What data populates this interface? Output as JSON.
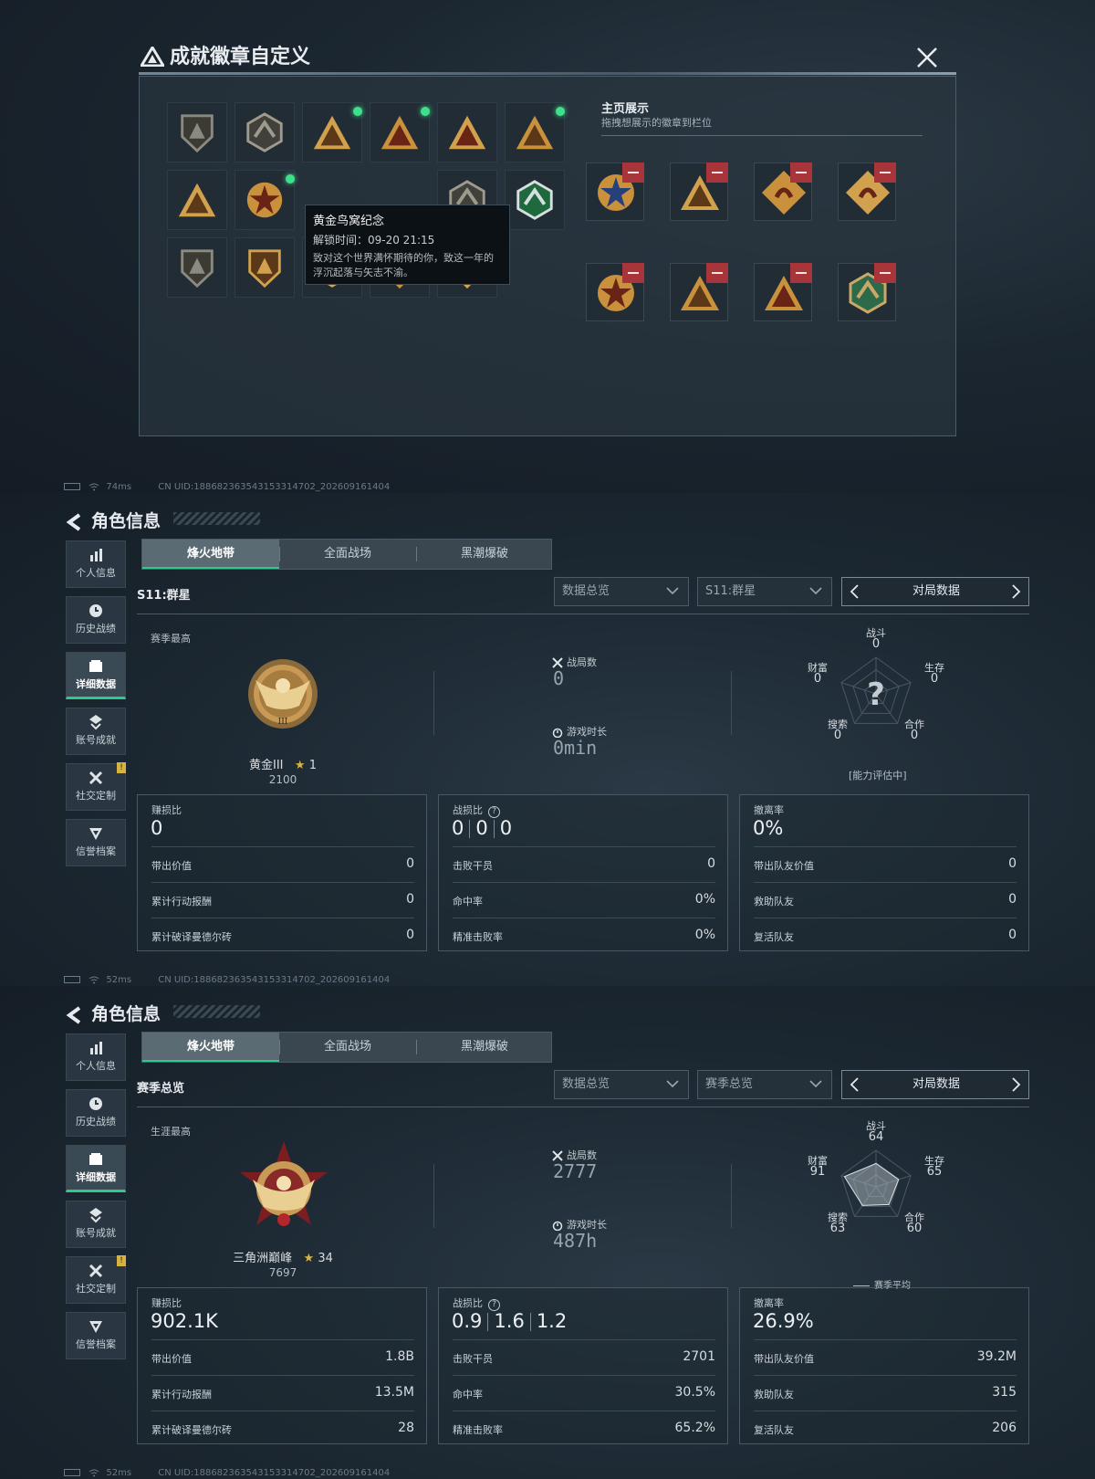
{
  "dialog": {
    "title": "成就徽章自定义",
    "tooltip": {
      "name": "黄金鸟窝纪念",
      "unlock": "解锁时间：09-20 21:15",
      "desc": "致对这个世界满怀期待的你，致这一年的浮沉起落与矢志不渝。"
    },
    "showcase_title": "主页展示",
    "showcase_hint": "拖拽想展示的徽章到栏位"
  },
  "status": [
    {
      "ping": "74ms",
      "uid": "CN UID:18868236354315331470​2_202609161404"
    },
    {
      "ping": "52ms",
      "uid": "CN UID:18868236354315331470​2_202609161404"
    },
    {
      "ping": "52ms",
      "uid": "CN UID:18868236354315331470​2_202609161404"
    }
  ],
  "nav": {
    "title": "角色信息",
    "side": [
      "个人信息",
      "历史战绩",
      "详细数据",
      "账号成就",
      "社交定制",
      "信誉档案"
    ],
    "tabs": [
      "烽火地带",
      "全面战场",
      "黑潮爆破"
    ],
    "pager_label": "对局数据",
    "select1": "数据总览"
  },
  "p1": {
    "section": "S11:群星",
    "select2": "S11:群星",
    "top_label": "赛季最高",
    "rank": "黄金III",
    "stars": "1",
    "points": "2100",
    "matches_label": "战局数",
    "matches": "0",
    "time_label": "游戏时长",
    "time": "0min",
    "radar": {
      "combat": "0",
      "survive": "0",
      "coop": "0",
      "search": "0",
      "wealth": "0",
      "center": "?",
      "note": "[能力评估中]"
    },
    "c1": {
      "title": "赚损比",
      "value": "0",
      "rows": [
        [
          "带出价值",
          "0"
        ],
        [
          "累计行动报酬",
          "0"
        ],
        [
          "累计破译曼德尔砖",
          "0"
        ]
      ]
    },
    "c2": {
      "title": "战损比",
      "v1": "0",
      "v2": "0",
      "v3": "0",
      "rows": [
        [
          "击败干员",
          "0"
        ],
        [
          "命中率",
          "0%"
        ],
        [
          "精准击败率",
          "0%"
        ]
      ]
    },
    "c3": {
      "title": "撤离率",
      "value": "0%",
      "rows": [
        [
          "带出队友价值",
          "0"
        ],
        [
          "救助队友",
          "0"
        ],
        [
          "复活队友",
          "0"
        ]
      ]
    }
  },
  "p2": {
    "section": "赛季总览",
    "select2": "赛季总览",
    "top_label": "生涯最高",
    "rank": "三角洲巅峰",
    "stars": "34",
    "points": "7697",
    "matches_label": "战局数",
    "matches": "2777",
    "time_label": "游戏时长",
    "time": "487h",
    "radar": {
      "combat": "64",
      "survive": "65",
      "coop": "60",
      "search": "63",
      "wealth": "91",
      "legend": "赛季平均"
    },
    "c1": {
      "title": "赚损比",
      "value": "902.1K",
      "rows": [
        [
          "带出价值",
          "1.8B"
        ],
        [
          "累计行动报酬",
          "13.5M"
        ],
        [
          "累计破译曼德尔砖",
          "28"
        ]
      ]
    },
    "c2": {
      "title": "战损比",
      "v1": "0.9",
      "v2": "1.6",
      "v3": "1.2",
      "rows": [
        [
          "击败干员",
          "2701"
        ],
        [
          "命中率",
          "30.5%"
        ],
        [
          "精准击败率",
          "65.2%"
        ]
      ]
    },
    "c3": {
      "title": "撤离率",
      "value": "26.9%",
      "rows": [
        [
          "带出队友价值",
          "39.2M"
        ],
        [
          "救助队友",
          "315"
        ],
        [
          "复活队友",
          "206"
        ]
      ]
    }
  },
  "radar_labels": {
    "combat": "战斗",
    "survive": "生存",
    "coop": "合作",
    "search": "搜索",
    "wealth": "财富"
  },
  "colors": {
    "accent": "#2fc98a",
    "new_dot": "#3fe08a",
    "remove": "#a7353a",
    "gold": "#d8b34a"
  }
}
